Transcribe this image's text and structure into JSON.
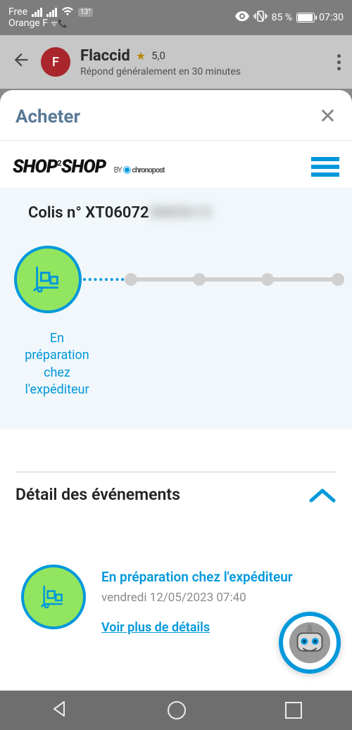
{
  "status": {
    "carrier_line1": "Free",
    "carrier_line2": "Orange F",
    "temp_badge": "13°",
    "battery": "85 %",
    "time": "07:30"
  },
  "chat": {
    "avatar_initial": "F",
    "name": "Flaccid",
    "rating": "5,0",
    "subtitle": "Répond généralement en 30 minutes"
  },
  "sheet": {
    "title": "Acheter"
  },
  "brand": {
    "logo_main": "SHOP",
    "logo_two": "2",
    "logo_by": "BY",
    "logo_carrier": "chronopost"
  },
  "parcel": {
    "label_prefix": "Colis n° ",
    "number_visible": "XT06072",
    "number_hidden": "5885613",
    "status_label": "En\npréparation\nchez\nl'expéditeur"
  },
  "details": {
    "heading": "Détail des événements"
  },
  "event": {
    "title": "En préparation chez l'expéditeur",
    "date": "vendredi 12/05/2023 07:40",
    "more": "Voir plus de détails"
  }
}
